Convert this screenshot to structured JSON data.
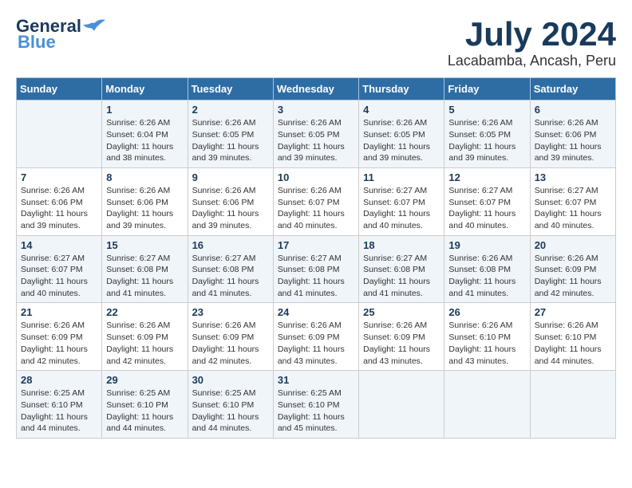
{
  "header": {
    "logo_general": "General",
    "logo_blue": "Blue",
    "month_title": "July 2024",
    "location": "Lacabamba, Ancash, Peru"
  },
  "days_of_week": [
    "Sunday",
    "Monday",
    "Tuesday",
    "Wednesday",
    "Thursday",
    "Friday",
    "Saturday"
  ],
  "weeks": [
    [
      {
        "day": "",
        "info": ""
      },
      {
        "day": "1",
        "info": "Sunrise: 6:26 AM\nSunset: 6:04 PM\nDaylight: 11 hours\nand 38 minutes."
      },
      {
        "day": "2",
        "info": "Sunrise: 6:26 AM\nSunset: 6:05 PM\nDaylight: 11 hours\nand 39 minutes."
      },
      {
        "day": "3",
        "info": "Sunrise: 6:26 AM\nSunset: 6:05 PM\nDaylight: 11 hours\nand 39 minutes."
      },
      {
        "day": "4",
        "info": "Sunrise: 6:26 AM\nSunset: 6:05 PM\nDaylight: 11 hours\nand 39 minutes."
      },
      {
        "day": "5",
        "info": "Sunrise: 6:26 AM\nSunset: 6:05 PM\nDaylight: 11 hours\nand 39 minutes."
      },
      {
        "day": "6",
        "info": "Sunrise: 6:26 AM\nSunset: 6:06 PM\nDaylight: 11 hours\nand 39 minutes."
      }
    ],
    [
      {
        "day": "7",
        "info": "Sunrise: 6:26 AM\nSunset: 6:06 PM\nDaylight: 11 hours\nand 39 minutes."
      },
      {
        "day": "8",
        "info": "Sunrise: 6:26 AM\nSunset: 6:06 PM\nDaylight: 11 hours\nand 39 minutes."
      },
      {
        "day": "9",
        "info": "Sunrise: 6:26 AM\nSunset: 6:06 PM\nDaylight: 11 hours\nand 39 minutes."
      },
      {
        "day": "10",
        "info": "Sunrise: 6:26 AM\nSunset: 6:07 PM\nDaylight: 11 hours\nand 40 minutes."
      },
      {
        "day": "11",
        "info": "Sunrise: 6:27 AM\nSunset: 6:07 PM\nDaylight: 11 hours\nand 40 minutes."
      },
      {
        "day": "12",
        "info": "Sunrise: 6:27 AM\nSunset: 6:07 PM\nDaylight: 11 hours\nand 40 minutes."
      },
      {
        "day": "13",
        "info": "Sunrise: 6:27 AM\nSunset: 6:07 PM\nDaylight: 11 hours\nand 40 minutes."
      }
    ],
    [
      {
        "day": "14",
        "info": "Sunrise: 6:27 AM\nSunset: 6:07 PM\nDaylight: 11 hours\nand 40 minutes."
      },
      {
        "day": "15",
        "info": "Sunrise: 6:27 AM\nSunset: 6:08 PM\nDaylight: 11 hours\nand 41 minutes."
      },
      {
        "day": "16",
        "info": "Sunrise: 6:27 AM\nSunset: 6:08 PM\nDaylight: 11 hours\nand 41 minutes."
      },
      {
        "day": "17",
        "info": "Sunrise: 6:27 AM\nSunset: 6:08 PM\nDaylight: 11 hours\nand 41 minutes."
      },
      {
        "day": "18",
        "info": "Sunrise: 6:27 AM\nSunset: 6:08 PM\nDaylight: 11 hours\nand 41 minutes."
      },
      {
        "day": "19",
        "info": "Sunrise: 6:26 AM\nSunset: 6:08 PM\nDaylight: 11 hours\nand 41 minutes."
      },
      {
        "day": "20",
        "info": "Sunrise: 6:26 AM\nSunset: 6:09 PM\nDaylight: 11 hours\nand 42 minutes."
      }
    ],
    [
      {
        "day": "21",
        "info": "Sunrise: 6:26 AM\nSunset: 6:09 PM\nDaylight: 11 hours\nand 42 minutes."
      },
      {
        "day": "22",
        "info": "Sunrise: 6:26 AM\nSunset: 6:09 PM\nDaylight: 11 hours\nand 42 minutes."
      },
      {
        "day": "23",
        "info": "Sunrise: 6:26 AM\nSunset: 6:09 PM\nDaylight: 11 hours\nand 42 minutes."
      },
      {
        "day": "24",
        "info": "Sunrise: 6:26 AM\nSunset: 6:09 PM\nDaylight: 11 hours\nand 43 minutes."
      },
      {
        "day": "25",
        "info": "Sunrise: 6:26 AM\nSunset: 6:09 PM\nDaylight: 11 hours\nand 43 minutes."
      },
      {
        "day": "26",
        "info": "Sunrise: 6:26 AM\nSunset: 6:10 PM\nDaylight: 11 hours\nand 43 minutes."
      },
      {
        "day": "27",
        "info": "Sunrise: 6:26 AM\nSunset: 6:10 PM\nDaylight: 11 hours\nand 44 minutes."
      }
    ],
    [
      {
        "day": "28",
        "info": "Sunrise: 6:25 AM\nSunset: 6:10 PM\nDaylight: 11 hours\nand 44 minutes."
      },
      {
        "day": "29",
        "info": "Sunrise: 6:25 AM\nSunset: 6:10 PM\nDaylight: 11 hours\nand 44 minutes."
      },
      {
        "day": "30",
        "info": "Sunrise: 6:25 AM\nSunset: 6:10 PM\nDaylight: 11 hours\nand 44 minutes."
      },
      {
        "day": "31",
        "info": "Sunrise: 6:25 AM\nSunset: 6:10 PM\nDaylight: 11 hours\nand 45 minutes."
      },
      {
        "day": "",
        "info": ""
      },
      {
        "day": "",
        "info": ""
      },
      {
        "day": "",
        "info": ""
      }
    ]
  ]
}
